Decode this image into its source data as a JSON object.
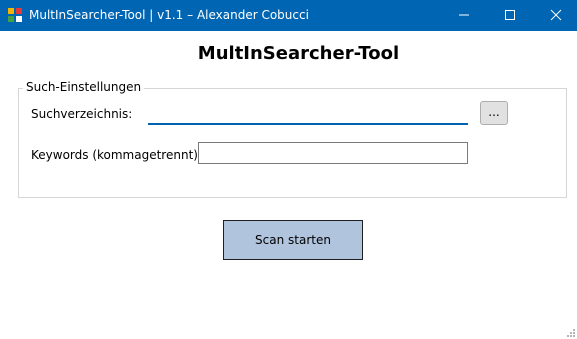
{
  "window": {
    "title": "MultInSearcher-Tool | v1.1 – Alexander Cobucci",
    "titlebar_color": "#0066b4"
  },
  "heading": "MultInSearcher-Tool",
  "settings": {
    "group_title": "Such-Einstellungen",
    "directory_label": "Suchverzeichnis:",
    "directory_value": "",
    "browse_label": "...",
    "keywords_label": "Keywords (kommagetrennt):",
    "keywords_value": ""
  },
  "scan_button": {
    "label": "Scan starten",
    "color": "#b0c4de"
  },
  "icons": [
    "app-icon",
    "minimize-icon",
    "maximize-icon",
    "close-icon",
    "resize-grip-icon"
  ]
}
